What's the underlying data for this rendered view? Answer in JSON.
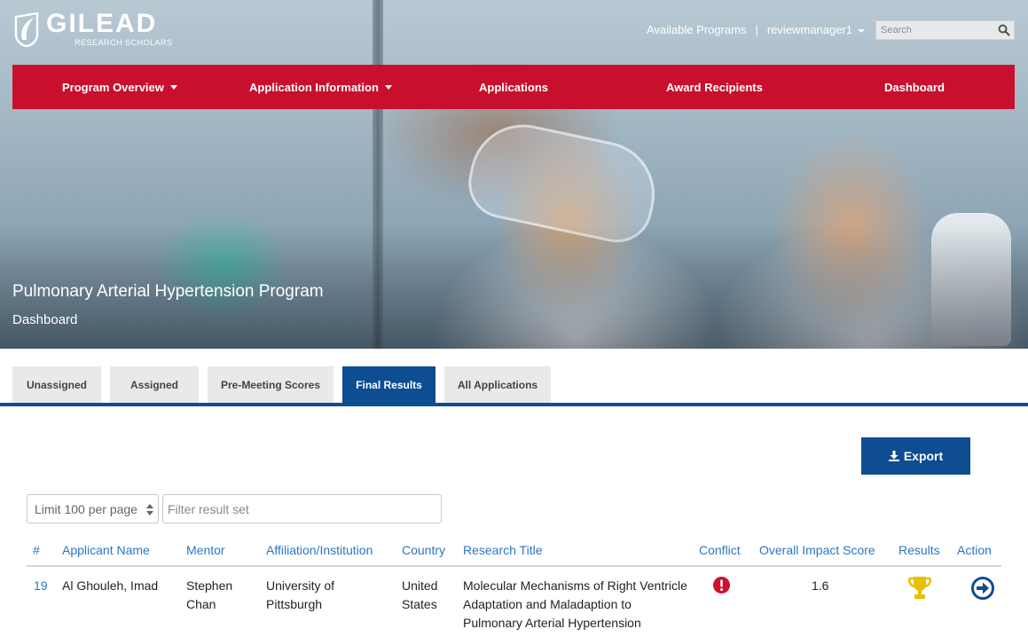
{
  "brand": {
    "name": "GILEAD",
    "subtitle": "RESEARCH SCHOLARS"
  },
  "topbar": {
    "available_programs": "Available Programs",
    "separator": "|",
    "user": "reviewmanager1"
  },
  "search": {
    "placeholder": "Search"
  },
  "nav": {
    "items": [
      {
        "label": "Program Overview",
        "has_dropdown": true
      },
      {
        "label": "Application Information",
        "has_dropdown": true
      },
      {
        "label": "Applications",
        "has_dropdown": false
      },
      {
        "label": "Award Recipients",
        "has_dropdown": false
      },
      {
        "label": "Dashboard",
        "has_dropdown": false
      }
    ]
  },
  "hero": {
    "title": "Pulmonary Arterial Hypertension Program",
    "subtitle": "Dashboard"
  },
  "tabs": [
    {
      "label": "Unassigned",
      "active": false
    },
    {
      "label": "Assigned",
      "active": false
    },
    {
      "label": "Pre-Meeting Scores",
      "active": false
    },
    {
      "label": "Final Results",
      "active": true
    },
    {
      "label": "All Applications",
      "active": false
    }
  ],
  "export": {
    "label": "Export"
  },
  "controls": {
    "limit_label": "Limit 100 per page",
    "filter_placeholder": "Filter result set"
  },
  "table": {
    "headers": [
      "#",
      "Applicant Name",
      "Mentor",
      "Affiliation/Institution",
      "Country",
      "Research Title",
      "Conflict",
      "Overall Impact Score",
      "Results",
      "Action"
    ],
    "rows": [
      {
        "id": "19",
        "applicant": "Al Ghouleh, Imad",
        "mentor": "Stephen Chan",
        "affiliation": "University of Pittsburgh",
        "country": "United States",
        "title": "Molecular Mechanisms of Right Ventricle Adaptation and Maladaption to Pulmonary Arterial Hypertension",
        "conflict": "conflict-alert-icon",
        "score": "1.6",
        "result": "trophy-icon",
        "action": "arrow-circle-right-icon"
      }
    ]
  },
  "colors": {
    "brand_red": "#c8102e",
    "primary_blue": "#0e4d92",
    "link_blue": "#2a78c5",
    "alert_red": "#d0102d",
    "trophy_gold": "#e8c000"
  }
}
